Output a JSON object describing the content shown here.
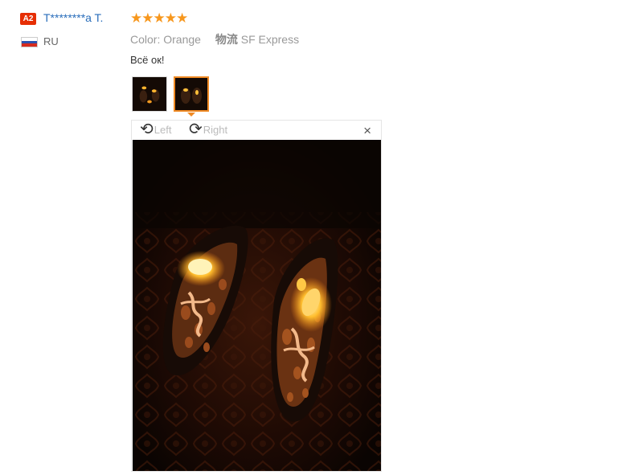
{
  "review": {
    "badge": "A2",
    "username": "T********a T.",
    "country": "RU",
    "stars": "★★★★★",
    "color_label": "Color:",
    "color_value": "Orange",
    "shipping_label": "物流",
    "shipping_value": "SF Express",
    "feedback": "Всё ок!"
  },
  "viewer": {
    "rotate_left": "Left",
    "rotate_right": "Right",
    "close": "×",
    "rotate_left_icon": "rotate-left-icon",
    "rotate_right_icon": "rotate-right-icon"
  },
  "colors": {
    "brand": "#e62e04",
    "link": "#2a6ebb",
    "star": "#f7971d",
    "selected_border": "#f08a24"
  }
}
